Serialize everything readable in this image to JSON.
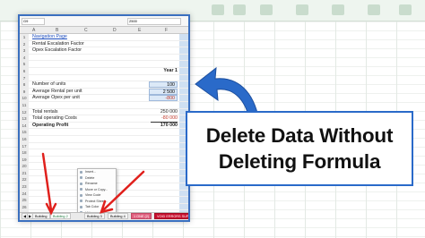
{
  "colors": {
    "accent_blue": "#2a6ac9",
    "arrow_red": "#e0201c",
    "excel_green": "#1e7a3e",
    "negative_red": "#c0392b"
  },
  "formula_bar": {
    "name_box": "G9",
    "formula": "2500"
  },
  "columns": [
    "A",
    "B",
    "C",
    "D",
    "E",
    "F",
    "G"
  ],
  "rows": [
    {
      "num": "1",
      "label": "Navigation Page",
      "style": "link",
      "c1": "",
      "c2": ""
    },
    {
      "num": "2",
      "label": "Rental Escalation Factor",
      "style": "",
      "c1": "",
      "c2": ""
    },
    {
      "num": "3",
      "label": "Opex Escalation Factor",
      "style": "",
      "c1": "",
      "c2": ""
    },
    {
      "num": "4",
      "label": "",
      "style": "",
      "c1": "",
      "c2": ""
    },
    {
      "num": "5",
      "label": "",
      "style": "",
      "c1": "",
      "c2": ""
    },
    {
      "num": "6",
      "label": "",
      "style": "header",
      "c1": "Year 1",
      "c2": "Yea"
    },
    {
      "num": "7",
      "label": "",
      "style": "",
      "c1": "",
      "c2": ""
    },
    {
      "num": "8",
      "label": "Number of units",
      "style": "input",
      "c1": "100",
      "c2": ""
    },
    {
      "num": "9",
      "label": "Average Rental per unit",
      "style": "input",
      "c1": "2 500",
      "c2": ""
    },
    {
      "num": "10",
      "label": "Average Opex per unit",
      "style": "input-neg",
      "c1": "-800",
      "c2": ""
    },
    {
      "num": "11",
      "label": "",
      "style": "",
      "c1": "",
      "c2": ""
    },
    {
      "num": "12",
      "label": "Total rentals",
      "style": "",
      "c1": "250 000",
      "c2": "26"
    },
    {
      "num": "13",
      "label": "Total operating Costs",
      "style": "neg",
      "c1": "-80 000",
      "c2": "-8"
    },
    {
      "num": "14",
      "label": "Operating Profit",
      "style": "bold",
      "c1": "170 000",
      "c2": "17"
    },
    {
      "num": "15",
      "label": "",
      "style": "",
      "c1": "",
      "c2": ""
    },
    {
      "num": "16",
      "label": "",
      "style": "",
      "c1": "",
      "c2": ""
    },
    {
      "num": "17",
      "label": "",
      "style": "",
      "c1": "",
      "c2": ""
    },
    {
      "num": "18",
      "label": "",
      "style": "",
      "c1": "",
      "c2": ""
    },
    {
      "num": "19",
      "label": "",
      "style": "",
      "c1": "",
      "c2": ""
    },
    {
      "num": "20",
      "label": "",
      "style": "",
      "c1": "",
      "c2": ""
    },
    {
      "num": "21",
      "label": "",
      "style": "",
      "c1": "",
      "c2": ""
    },
    {
      "num": "22",
      "label": "",
      "style": "",
      "c1": "",
      "c2": ""
    },
    {
      "num": "23",
      "label": "",
      "style": "",
      "c1": "",
      "c2": ""
    },
    {
      "num": "24",
      "label": "",
      "style": "",
      "c1": "",
      "c2": ""
    },
    {
      "num": "25",
      "label": "",
      "style": "",
      "c1": "",
      "c2": ""
    },
    {
      "num": "26",
      "label": "",
      "style": "",
      "c1": "",
      "c2": ""
    },
    {
      "num": "27",
      "label": "",
      "style": "",
      "c1": "",
      "c2": ""
    },
    {
      "num": "28",
      "label": "",
      "style": "",
      "c1": "",
      "c2": ""
    },
    {
      "num": "29",
      "label": "",
      "style": "",
      "c1": "",
      "c2": ""
    },
    {
      "num": "30",
      "label": "",
      "style": "",
      "c1": "",
      "c2": ""
    }
  ],
  "context_menu": {
    "items": [
      "Insert...",
      "Delete",
      "Rename",
      "Move or Copy...",
      "View Code",
      "Protect Sheet...",
      "Tab Color",
      "Hide",
      "Unhide...",
      "Select All Sheets"
    ],
    "highlighted": "Ungroup Sheets"
  },
  "sheet_tabs": [
    {
      "label": "Building",
      "style": ""
    },
    {
      "label": "Building 2",
      "style": "active"
    },
    {
      "label": "Building 3",
      "style": ""
    },
    {
      "label": "Building 4",
      "style": ""
    },
    {
      "label": "1 ONE (2)",
      "style": "pink"
    },
    {
      "label": "VOID ERRORS SUPPRESS",
      "style": "red"
    }
  ],
  "caption": {
    "line1": "Delete Data Without",
    "line2": "Deleting Formula"
  }
}
